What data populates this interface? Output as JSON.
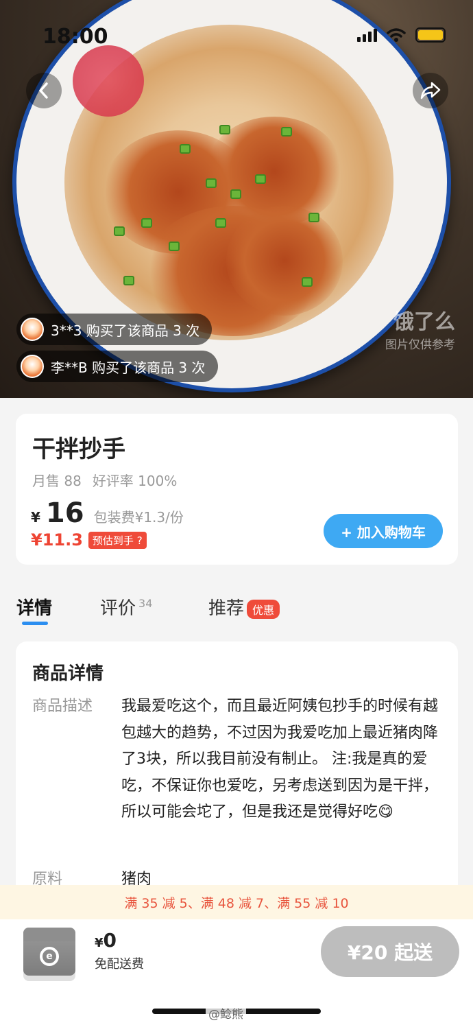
{
  "status_bar": {
    "time": "18:00"
  },
  "hero": {
    "watermark_brand": "饿了么",
    "watermark_note": "图片仅供参考",
    "buyers": [
      {
        "text": "3**3 购买了该商品 3 次"
      },
      {
        "text": "李**B 购买了该商品 3 次"
      }
    ],
    "back_icon": "chevron-left-icon",
    "share_icon": "share-arrow-icon"
  },
  "product": {
    "name": "干拌抄手",
    "monthly_sales": "月售 88",
    "rating": "好评率 100%",
    "currency": "¥",
    "price": "16",
    "packaging": "包装费¥1.3/份",
    "estimated_price": "¥11.3",
    "estimated_tag": "预估到手 ?",
    "add_to_cart": "+ 加入购物车"
  },
  "tabs": {
    "details": "详情",
    "reviews": "评价",
    "reviews_count": "34",
    "recommend": "推荐",
    "recommend_badge": "优惠"
  },
  "details": {
    "title": "商品详情",
    "desc_label": "商品描述",
    "desc_value": "我最爱吃这个，而且最近阿姨包抄手的时候有越包越大的趋势，不过因为我爱吃加上最近猪肉降了3块，所以我目前没有制止。 注:我是真的爱吃，不保证你也爱吃，另考虑送到因为是干拌，所以可能会坨了，但是我还是觉得好吃😋",
    "ingredient_label": "原料",
    "ingredient_value": "猪肉"
  },
  "promo": {
    "text": "满 35 减 5、满 48 减 7、满 55 减 10"
  },
  "bottom_bar": {
    "currency": "¥",
    "delivery_amount": "0",
    "delivery_note": "免配送费",
    "min_order": "¥20 起送",
    "credit": "@鲶熊"
  },
  "colors": {
    "accent_blue": "#3ea9f3",
    "promo_red": "#ef4b3a",
    "tab_blue": "#2b8ef0"
  }
}
